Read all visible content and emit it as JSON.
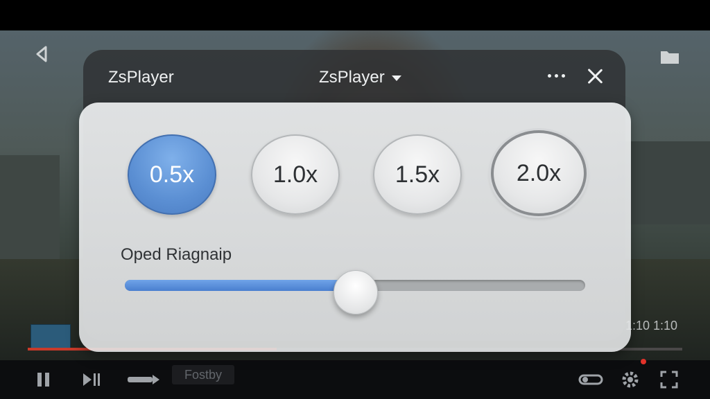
{
  "player": {
    "timecode": "1:10 1:10",
    "progress": 0.38,
    "bottom_label": "Fostby"
  },
  "dialog": {
    "title_left": "ZsPlayer",
    "title_center": "ZsPlayer",
    "speeds": [
      "0.5x",
      "1.0x",
      "1.5x",
      "2.0x"
    ],
    "selected_speed": "0.5x",
    "slider_label": "Oped Riagnaip",
    "slider_value": 0.5
  },
  "colors": {
    "accent": "#5b8fd3",
    "progress_red": "#c93a2a"
  },
  "icons": [
    "back-icon",
    "folder-icon",
    "more-icon",
    "close-icon",
    "pause-icon",
    "skip-next-icon",
    "volume-icon",
    "toggle-icon",
    "settings-icon",
    "fullscreen-icon"
  ]
}
